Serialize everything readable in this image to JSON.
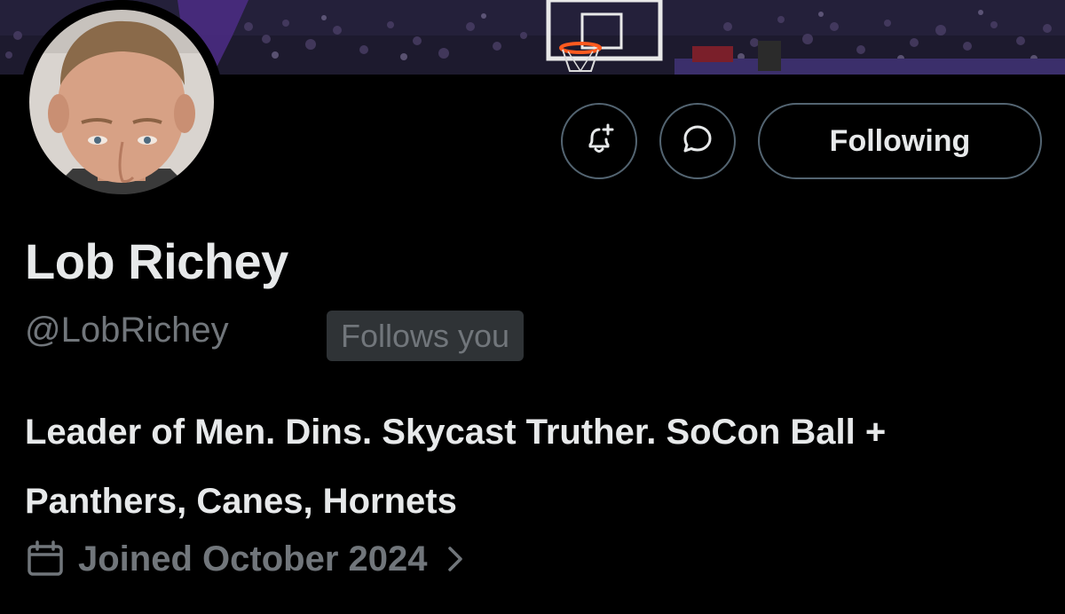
{
  "profile": {
    "display_name": "Lob Richey",
    "handle": "@LobRichey",
    "follows_you_badge": "Follows you",
    "bio": "Leader of Men. Dins. Skycast Truther. SoCon Ball + Panthers, Canes, Hornets",
    "joined": "Joined October 2024"
  },
  "actions": {
    "notify_icon": "bell-plus-icon",
    "message_icon": "chat-bubble-icon",
    "following_label": "Following"
  },
  "icons": {
    "calendar": "calendar-icon",
    "chevron": "chevron-right-icon"
  },
  "colors": {
    "background": "#000000",
    "primary_text": "#e7e9ea",
    "secondary_text": "#71767b",
    "border": "#536471",
    "badge_bg": "#2f3336"
  }
}
